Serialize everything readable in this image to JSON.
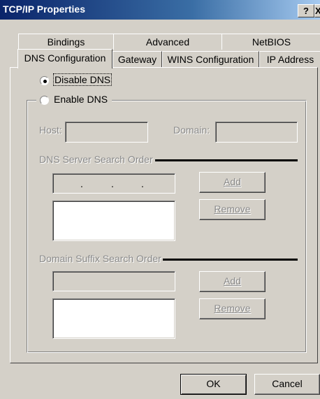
{
  "window": {
    "title": "TCP/IP Properties",
    "help_label": "?",
    "close_label": "X"
  },
  "tabs": {
    "back_row": [
      {
        "label": "Bindings"
      },
      {
        "label": "Advanced"
      },
      {
        "label": "NetBIOS"
      }
    ],
    "front_row": [
      {
        "label": "DNS Configuration"
      },
      {
        "label": "Gateway"
      },
      {
        "label": "WINS Configuration"
      },
      {
        "label": "IP Address"
      }
    ],
    "active": "DNS Configuration"
  },
  "dns": {
    "disable_label": "Disable DNS",
    "enable_label": "Enable DNS",
    "selected": "Disable DNS",
    "host_label": "Host:",
    "host_value": "",
    "domain_label": "Domain:",
    "domain_value": "",
    "server_group_label": "DNS Server Search Order",
    "ip_separator": ".",
    "add_label": "Add",
    "remove_label": "Remove",
    "suffix_group_label": "Domain Suffix Search Order",
    "suffix_add_label": "Add",
    "suffix_remove_label": "Remove"
  },
  "footer": {
    "ok_label": "OK",
    "cancel_label": "Cancel"
  }
}
